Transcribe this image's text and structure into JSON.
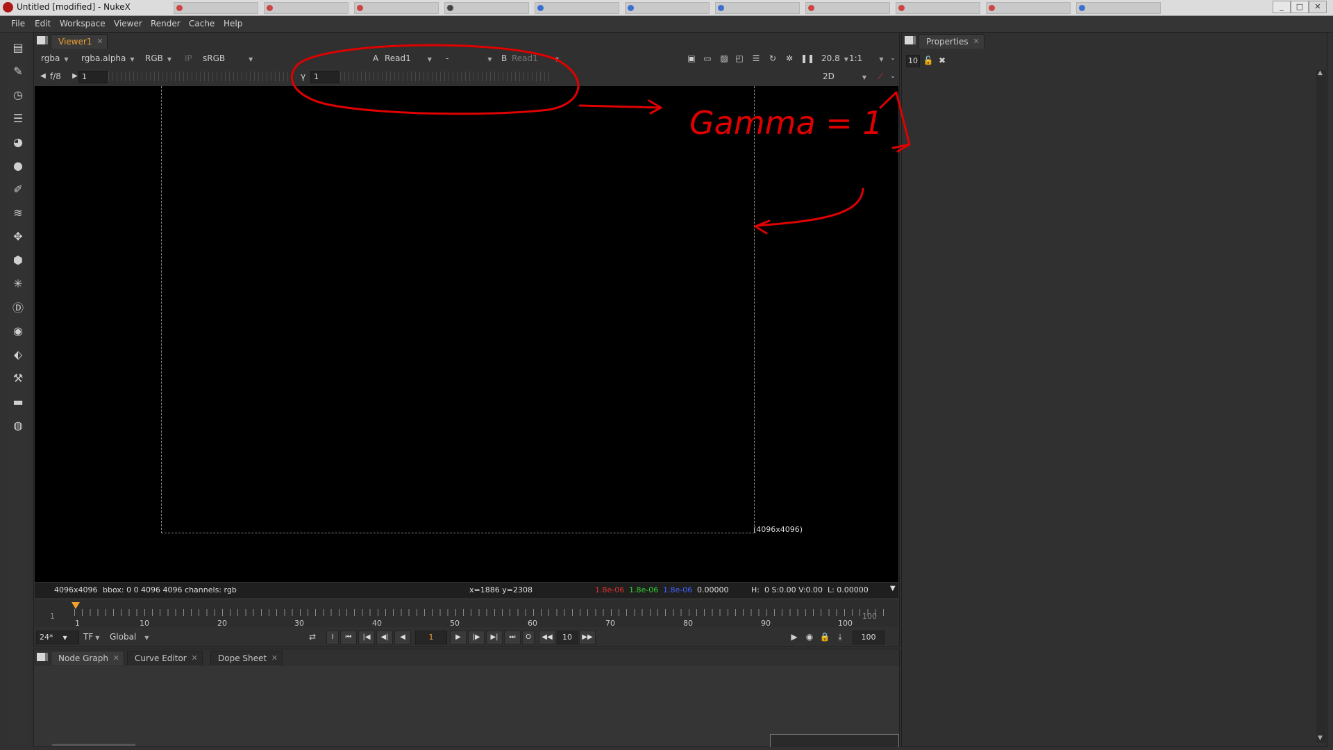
{
  "window": {
    "title": "Untitled [modified] - NukeX",
    "controls": {
      "minimize": "_",
      "maximize": "□",
      "close": "✕"
    }
  },
  "menu": [
    "File",
    "Edit",
    "Workspace",
    "Viewer",
    "Render",
    "Cache",
    "Help"
  ],
  "toolbar_icons": [
    "image-icon",
    "draw-icon",
    "time-icon",
    "channel-icon",
    "color-icon",
    "filter-icon",
    "keyer-icon",
    "merge-icon",
    "transform-icon",
    "3d-icon",
    "particles-icon",
    "deep-icon",
    "views-icon",
    "metadata-icon",
    "toolsets-icon",
    "other-icon",
    "furnace-icon"
  ],
  "viewer": {
    "tab_label": "Viewer1",
    "channels": "rgba",
    "alpha_channel": "rgba.alpha",
    "display_channels": "RGB",
    "ip_label": "IP",
    "lut": "sRGB",
    "input_a_label": "A",
    "input_a": "Read1",
    "compare_mode": "-",
    "input_b_label": "B",
    "input_b": "Read1",
    "zoom": "20.8",
    "proxy": "1:1",
    "fstop_label": "f/8",
    "gain_value": "1",
    "gamma_label": "γ",
    "gamma_value": "1",
    "view_mode": "2D",
    "format_label": "(4096x4096)",
    "info": {
      "format": "4096x4096",
      "bbox": "bbox: 0 0 4096 4096 channels: rgb",
      "coords": "x=1886 y=2308",
      "r": "1.8e-06",
      "g": "1.8e-06",
      "b": "1.8e-06",
      "a": "0.00000",
      "hsvl": "H:  0 S:0.00 V:0.00  L: 0.00000"
    }
  },
  "timeline": {
    "start": "1",
    "end": "100",
    "current_frame_marker": "1",
    "labels": [
      "1",
      "10",
      "20",
      "30",
      "40",
      "50",
      "60",
      "70",
      "80",
      "90",
      "100"
    ]
  },
  "playback": {
    "fps": "24*",
    "tf": "TF",
    "range_mode": "Global",
    "current_frame": "1",
    "increment": "10",
    "end_frame": "100",
    "in_point": "I",
    "out_point": "O"
  },
  "bottom_tabs": [
    "Node Graph",
    "Curve Editor",
    "Dope Sheet"
  ],
  "properties": {
    "tab_label": "Properties",
    "max_panels": "10"
  },
  "annotation": {
    "text": "Gamma = 1",
    "color": "#e00000"
  },
  "colors": {
    "accent": "#f0a030",
    "red_channel": "#e03030",
    "green_channel": "#30d030",
    "blue_channel": "#4060ff"
  }
}
